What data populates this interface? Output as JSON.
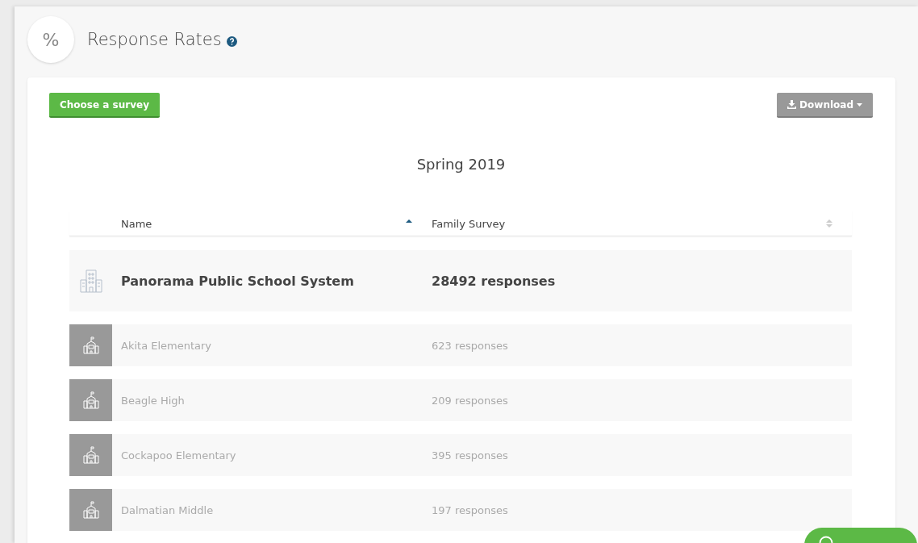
{
  "header": {
    "icon_text": "%",
    "title": "Response Rates"
  },
  "toolbar": {
    "choose_button": "Choose a survey",
    "download_button": "Download"
  },
  "survey_title": "Spring 2019",
  "table": {
    "columns": [
      {
        "label": "Name",
        "sorted": true
      },
      {
        "label": "Family Survey",
        "sorted": false
      }
    ],
    "total_row": {
      "name": "Panorama Public School System",
      "responses": "28492 responses"
    },
    "rows": [
      {
        "name": "Akita Elementary",
        "responses": "623 responses"
      },
      {
        "name": "Beagle High",
        "responses": "209 responses"
      },
      {
        "name": "Cockapoo Elementary",
        "responses": "395 responses"
      },
      {
        "name": "Dalmatian Middle",
        "responses": "197 responses"
      }
    ]
  }
}
